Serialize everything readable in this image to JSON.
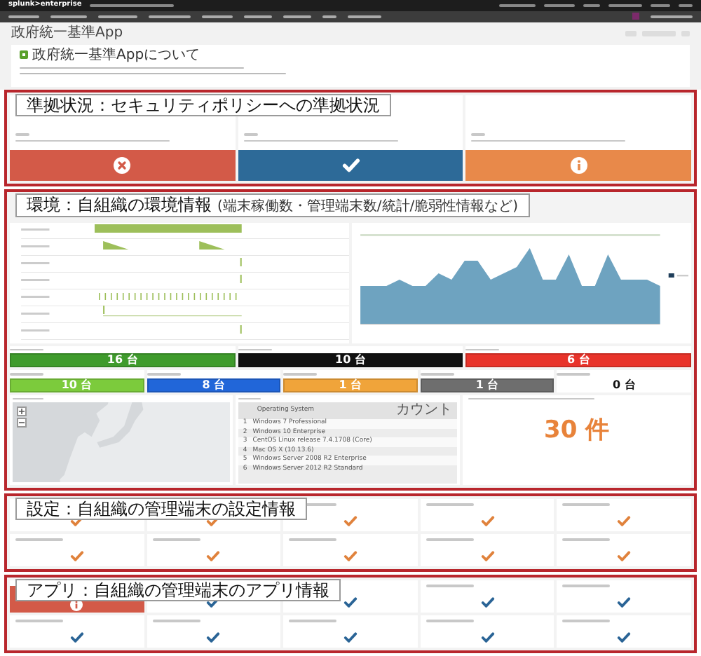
{
  "top_bar": {
    "brand": "splunk>enterprise"
  },
  "header": {
    "title": "政府統一基準App",
    "panel_title": "政府統一基準Appについて"
  },
  "compliance": {
    "callout": "準拠状況：セキュリティポリシーへの準拠状況",
    "items": [
      {
        "kind": "fail"
      },
      {
        "kind": "pass"
      },
      {
        "kind": "info"
      }
    ]
  },
  "environment": {
    "callout": "環境：自組織の環境情報",
    "callout_note": "(端末稼働数・管理端末数/統計/脆弱性情報など)",
    "stats_top": [
      {
        "value": "16 台",
        "color": "#3f9b2c"
      },
      {
        "value": "10 台",
        "color": "#111111"
      },
      {
        "value": "6 台",
        "color": "#e8332a"
      }
    ],
    "stats_bottom": [
      {
        "value": "10 台",
        "color": "#7ccb3c"
      },
      {
        "value": "8 台",
        "color": "#2166d9"
      },
      {
        "value": "1 台",
        "color": "#f0a43a"
      },
      {
        "value": "1 台",
        "color": "#6e6e6e"
      },
      {
        "value": "0 台",
        "color": "#ffffff"
      }
    ],
    "os_table": {
      "columns": [
        "Operating System",
        "カウント"
      ],
      "rows": [
        {
          "index": "1",
          "name": "Windows 7 Professional"
        },
        {
          "index": "2",
          "name": "Windows 10 Enterprise"
        },
        {
          "index": "3",
          "name": "CentOS Linux release 7.4.1708 (Core)"
        },
        {
          "index": "4",
          "name": "Mac OS X (10.13.6)"
        },
        {
          "index": "5",
          "name": "Windows Server 2008 R2 Enterprise"
        },
        {
          "index": "6",
          "name": "Windows Server 2012 R2 Standard"
        }
      ]
    },
    "vulnerability_count": "30 件"
  },
  "settings": {
    "callout": "設定：自組織の管理端末の設定情報",
    "items": [
      {
        "kind": "check"
      },
      {
        "kind": "check"
      },
      {
        "kind": "check"
      },
      {
        "kind": "check"
      },
      {
        "kind": "check"
      },
      {
        "kind": "check"
      },
      {
        "kind": "check"
      },
      {
        "kind": "check"
      },
      {
        "kind": "check"
      },
      {
        "kind": "check"
      }
    ]
  },
  "apps": {
    "callout": "アプリ：自組織の管理端末のアプリ情報",
    "items": [
      {
        "kind": "alert"
      },
      {
        "kind": "check"
      },
      {
        "kind": "check"
      },
      {
        "kind": "check"
      },
      {
        "kind": "check"
      },
      {
        "kind": "check"
      },
      {
        "kind": "check"
      },
      {
        "kind": "check"
      },
      {
        "kind": "check"
      },
      {
        "kind": "check"
      }
    ]
  }
}
